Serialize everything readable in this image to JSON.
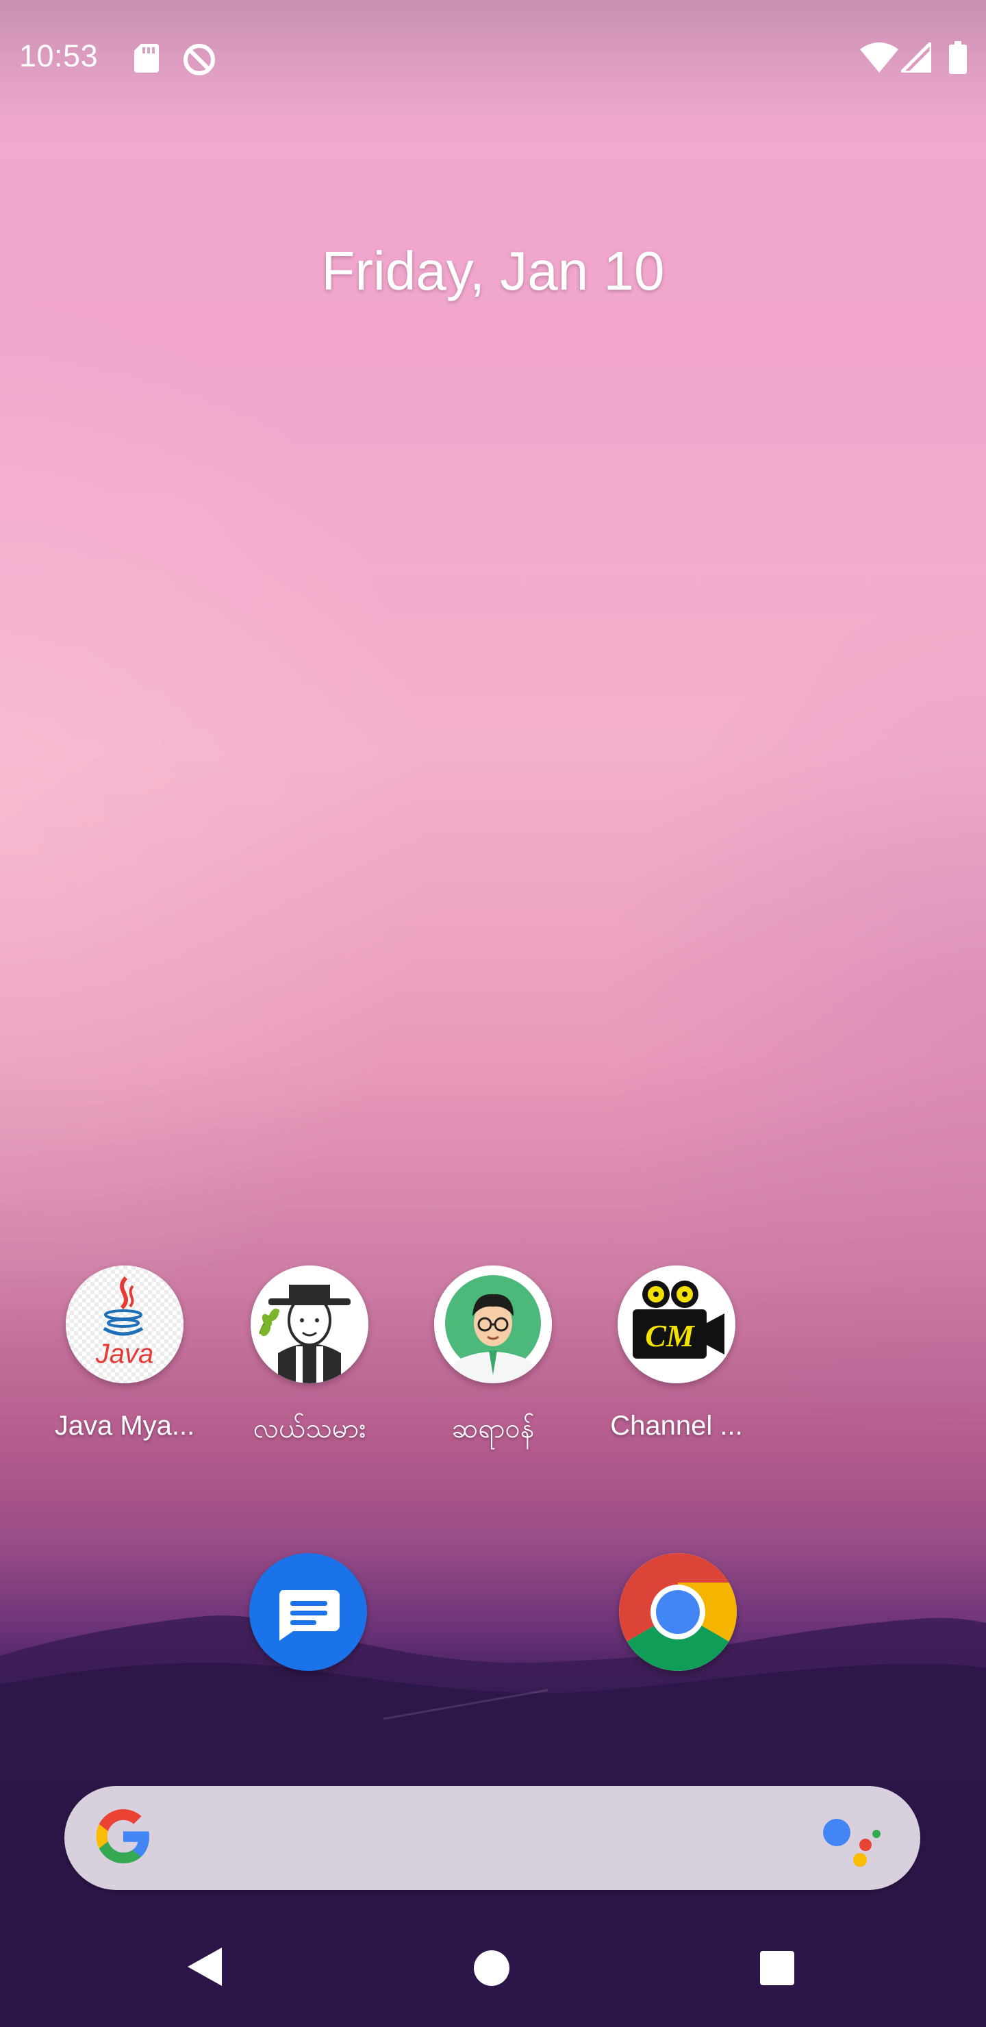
{
  "status_bar": {
    "time": "10:53",
    "icons": [
      "sd-card-icon",
      "do-not-disturb-icon",
      "wifi-icon",
      "cell-signal-icon",
      "battery-icon"
    ]
  },
  "date": "Friday, Jan 10",
  "apps": [
    {
      "label": "Java Mya...",
      "icon": "java-app-icon"
    },
    {
      "label": "လယ်သမား",
      "icon": "farmer-app-icon"
    },
    {
      "label": "ဆရာဝန်",
      "icon": "doctor-app-icon"
    },
    {
      "label": "Channel ...",
      "icon": "channel-myanmar-app-icon"
    }
  ],
  "dock": [
    {
      "icon": "messages-icon"
    },
    {
      "icon": "chrome-icon"
    }
  ],
  "search_bar": {
    "icons": [
      "google-g-icon",
      "google-assistant-icon"
    ]
  },
  "nav_bar": {
    "icons": [
      "back-icon",
      "home-icon",
      "recents-icon"
    ]
  },
  "colors": {
    "search_bar_bg": "#d8d0dd",
    "messages_blue": "#1a73e8",
    "chrome_red": "#db4437",
    "chrome_yellow": "#f4b400",
    "chrome_green": "#0f9d58",
    "chrome_blue": "#4285f4"
  }
}
